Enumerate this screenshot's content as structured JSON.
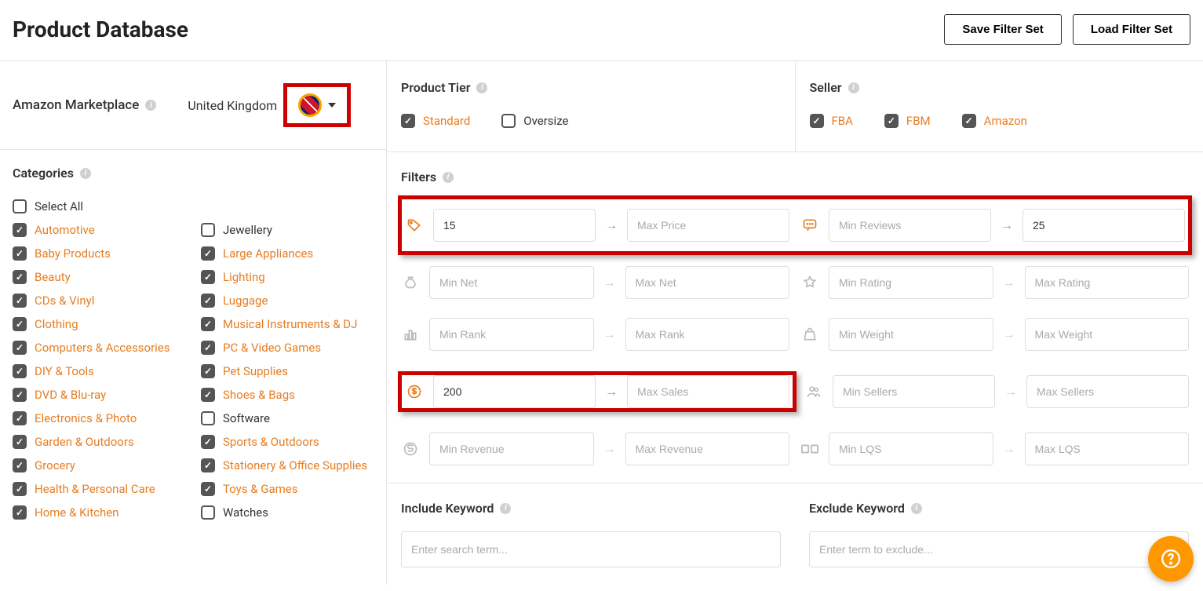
{
  "header": {
    "title": "Product Database",
    "save_btn": "Save Filter Set",
    "load_btn": "Load Filter Set"
  },
  "marketplace": {
    "label": "Amazon Marketplace",
    "country": "United Kingdom"
  },
  "categories": {
    "title": "Categories",
    "select_all": "Select All",
    "col1": [
      {
        "label": "Automotive",
        "checked": true
      },
      {
        "label": "Baby Products",
        "checked": true
      },
      {
        "label": "Beauty",
        "checked": true
      },
      {
        "label": "CDs & Vinyl",
        "checked": true
      },
      {
        "label": "Clothing",
        "checked": true
      },
      {
        "label": "Computers & Accessories",
        "checked": true
      },
      {
        "label": "DIY & Tools",
        "checked": true
      },
      {
        "label": "DVD & Blu-ray",
        "checked": true
      },
      {
        "label": "Electronics & Photo",
        "checked": true
      },
      {
        "label": "Garden & Outdoors",
        "checked": true
      },
      {
        "label": "Grocery",
        "checked": true
      },
      {
        "label": "Health & Personal Care",
        "checked": true
      },
      {
        "label": "Home & Kitchen",
        "checked": true
      }
    ],
    "col2": [
      {
        "label": "Jewellery",
        "checked": false
      },
      {
        "label": "Large Appliances",
        "checked": true
      },
      {
        "label": "Lighting",
        "checked": true
      },
      {
        "label": "Luggage",
        "checked": true
      },
      {
        "label": "Musical Instruments & DJ",
        "checked": true
      },
      {
        "label": "PC & Video Games",
        "checked": true
      },
      {
        "label": "Pet Supplies",
        "checked": true
      },
      {
        "label": "Shoes & Bags",
        "checked": true
      },
      {
        "label": "Software",
        "checked": false
      },
      {
        "label": "Sports & Outdoors",
        "checked": true
      },
      {
        "label": "Stationery & Office Supplies",
        "checked": true
      },
      {
        "label": "Toys & Games",
        "checked": true
      },
      {
        "label": "Watches",
        "checked": false
      }
    ]
  },
  "product_tier": {
    "title": "Product Tier",
    "options": [
      {
        "label": "Standard",
        "checked": true
      },
      {
        "label": "Oversize",
        "checked": false
      }
    ]
  },
  "seller": {
    "title": "Seller",
    "options": [
      {
        "label": "FBA",
        "checked": true
      },
      {
        "label": "FBM",
        "checked": true
      },
      {
        "label": "Amazon",
        "checked": true
      }
    ]
  },
  "filters": {
    "title": "Filters",
    "price_min": "15",
    "price_max_ph": "Max Price",
    "reviews_min_ph": "Min Reviews",
    "reviews_max": "25",
    "net_min_ph": "Min Net",
    "net_max_ph": "Max Net",
    "rating_min_ph": "Min Rating",
    "rating_max_ph": "Max Rating",
    "rank_min_ph": "Min Rank",
    "rank_max_ph": "Max Rank",
    "weight_min_ph": "Min Weight",
    "weight_max_ph": "Max Weight",
    "sales_min": "200",
    "sales_max_ph": "Max Sales",
    "sellers_min_ph": "Min Sellers",
    "sellers_max_ph": "Max Sellers",
    "revenue_min_ph": "Min Revenue",
    "revenue_max_ph": "Max Revenue",
    "lqs_min_ph": "Min LQS",
    "lqs_max_ph": "Max LQS"
  },
  "keywords": {
    "include_title": "Include Keyword",
    "include_ph": "Enter search term...",
    "exclude_title": "Exclude Keyword",
    "exclude_ph": "Enter term to exclude..."
  }
}
